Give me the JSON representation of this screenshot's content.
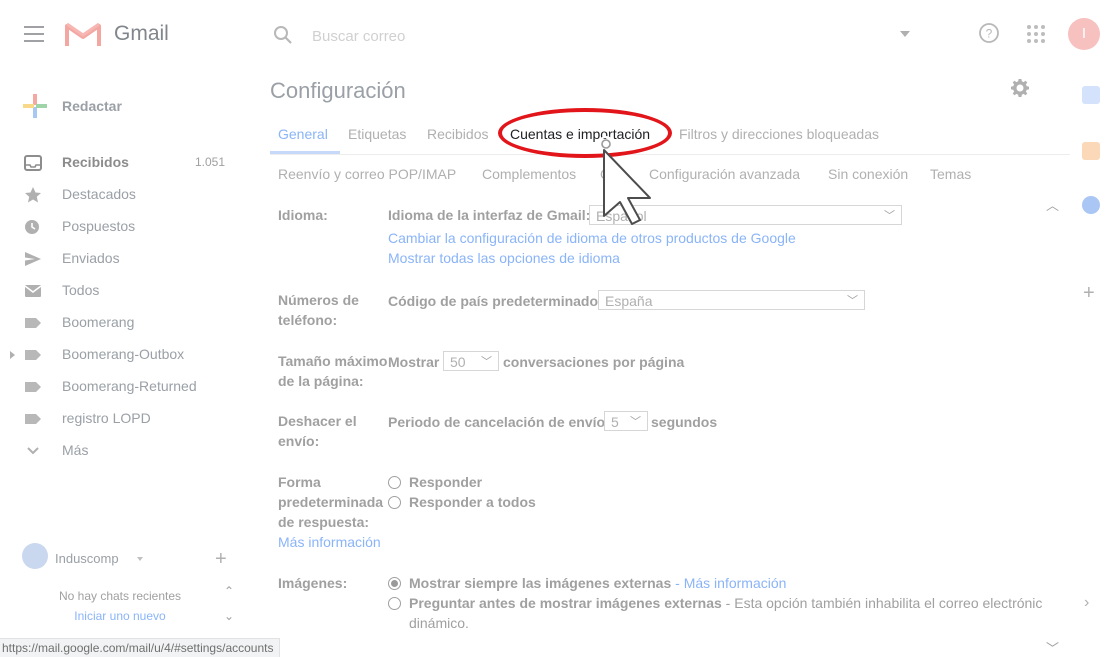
{
  "header": {
    "app_name": "Gmail",
    "search_placeholder": "Buscar correo",
    "avatar_initial": "I"
  },
  "sidebar": {
    "compose_label": "Redactar",
    "items": [
      {
        "label": "Recibidos",
        "count": "1.051",
        "icon": "inbox-icon"
      },
      {
        "label": "Destacados",
        "icon": "star-icon"
      },
      {
        "label": "Pospuestos",
        "icon": "clock-icon"
      },
      {
        "label": "Enviados",
        "icon": "send-icon"
      },
      {
        "label": "Todos",
        "icon": "mail-icon"
      },
      {
        "label": "Boomerang",
        "icon": "label-icon"
      },
      {
        "label": "Boomerang-Outbox",
        "icon": "label-icon"
      },
      {
        "label": "Boomerang-Returned",
        "icon": "label-icon"
      },
      {
        "label": "registro LOPD",
        "icon": "label-icon"
      },
      {
        "label": "Más",
        "icon": "chevron-down-icon"
      }
    ],
    "hangouts": {
      "user_name": "Induscomp",
      "no_chats": "No hay chats recientes",
      "new_chat": "Iniciar uno nuevo"
    }
  },
  "settings": {
    "title": "Configuración",
    "tabs_row1": [
      "General",
      "Etiquetas",
      "Recibidos",
      "Cuentas e importación",
      "Filtros y direcciones bloqueadas"
    ],
    "tabs_row2": [
      "Reenvío y correo POP/IMAP",
      "Complementos",
      "C",
      "Configuración avanzada",
      "Sin conexión",
      "Temas"
    ],
    "language": {
      "label": "Idioma:",
      "interface_label": "Idioma de la interfaz de Gmail:",
      "interface_value": "Español",
      "link1": "Cambiar la configuración de idioma de otros productos de Google",
      "link2": "Mostrar todas las opciones de idioma"
    },
    "phone": {
      "label_line1": "Números de",
      "label_line2": "teléfono:",
      "country_label": "Código de país predeterminado:",
      "country_value": "España"
    },
    "page_size": {
      "label_line1": "Tamaño máximo",
      "label_line2": "de la página:",
      "prefix": "Mostrar",
      "value": "50",
      "suffix": "conversaciones por página"
    },
    "undo_send": {
      "label_line1": "Deshacer el",
      "label_line2": "envío:",
      "prefix": "Periodo de cancelación de envío:",
      "value": "5",
      "suffix": "segundos"
    },
    "reply": {
      "label_line1": "Forma",
      "label_line2": "predeterminada",
      "label_line3": "de respuesta:",
      "more_info": "Más información",
      "option1": "Responder",
      "option2": "Responder a todos"
    },
    "images": {
      "label": "Imágenes:",
      "option1": "Mostrar siempre las imágenes externas",
      "option1_sep": " - ",
      "option1_link": "Más información",
      "option2": "Preguntar antes de mostrar imágenes externas",
      "option2_desc": " - Esta opción también inhabilita el correo electrónic",
      "option2_desc2": "dinámico."
    }
  },
  "status_bar": {
    "url": "https://mail.google.com/mail/u/4/#settings/accounts"
  },
  "colors": {
    "highlight": "#e1151a",
    "link": "#8ab4f8"
  }
}
